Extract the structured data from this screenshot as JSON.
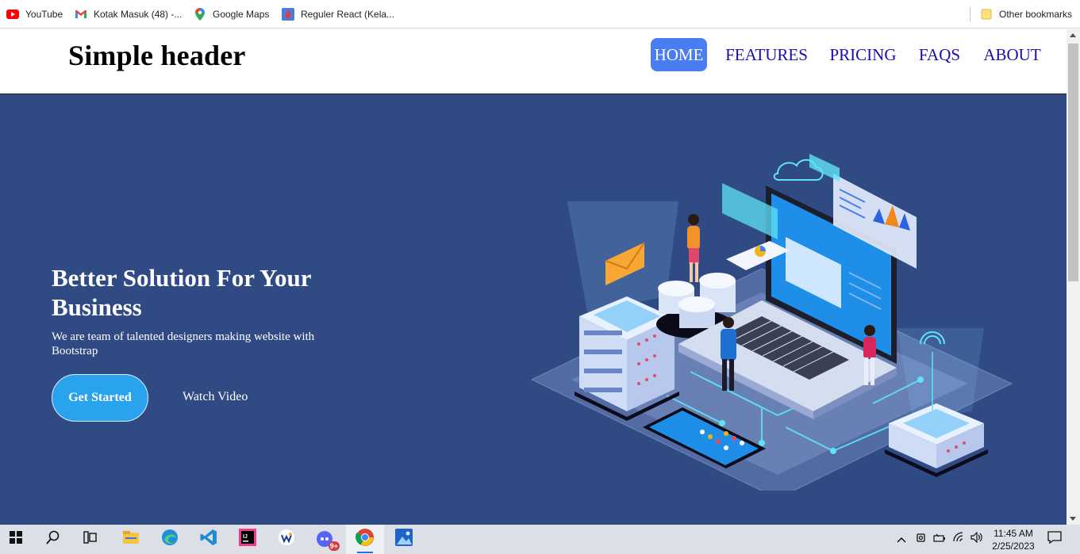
{
  "bookmarks": {
    "items": [
      {
        "label": "YouTube",
        "icon": "youtube-icon"
      },
      {
        "label": "Kotak Masuk (48) -...",
        "icon": "gmail-icon"
      },
      {
        "label": "Google Maps",
        "icon": "maps-pin-icon"
      },
      {
        "label": "Reguler React (Kela...",
        "icon": "site-favicon-icon"
      }
    ],
    "other": "Other bookmarks"
  },
  "header": {
    "brand": "Simple header",
    "nav": [
      "HOME",
      "FEATURES",
      "PRICING",
      "FAQS",
      "ABOUT"
    ],
    "active_index": 0
  },
  "hero": {
    "title": "Better Solution For Your Business",
    "subtitle": "We are team of talented designers making website with Bootstrap",
    "primary_button": "Get Started",
    "secondary_link": "Watch Video",
    "illustration": "isometric-laptop-servers-illustration"
  },
  "taskbar": {
    "apps": [
      "start-icon",
      "search-icon",
      "task-view-icon",
      "file-explorer-icon",
      "edge-icon",
      "vscode-icon",
      "intellij-icon",
      "app-icon",
      "discord-icon",
      "chrome-icon",
      "photos-icon"
    ],
    "notification_badge": "9+",
    "time": "11:45 AM",
    "date": "2/25/2023"
  },
  "colors": {
    "hero_bg": "#304a84",
    "nav_active_bg": "#4a7cf2",
    "nav_link": "#1a0dab",
    "button_primary": "#29a3ee"
  }
}
